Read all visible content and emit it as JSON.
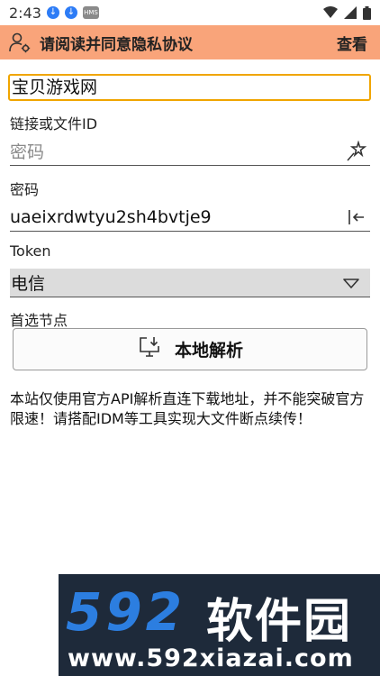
{
  "status_bar": {
    "time": "2:43",
    "hms_label": "HMS"
  },
  "app_bar": {
    "title": "请阅读并同意隐私协议",
    "view_label": "查看"
  },
  "name_field": {
    "value": "宝贝游戏网"
  },
  "link_label": "链接或文件ID",
  "link_field": {
    "placeholder": "密码"
  },
  "password_label": "密码",
  "password_field": {
    "value": "uaeixrdwtyu2sh4bvtje9"
  },
  "token_label": "Token",
  "node_select": {
    "selected": "电信"
  },
  "node_label": "首选节点",
  "parse_button": {
    "label": "本地解析"
  },
  "notice": "本站仅使用官方API解析直连下载地址，并不能突破官方限速！请搭配IDM等工具实现大文件断点续传！",
  "watermark": {
    "number": "592",
    "name": "软件园",
    "url": "www.592xiazai.com"
  },
  "colors": {
    "app_bar": "#f9a47a",
    "focus_border": "#f0a500",
    "watermark_bg": "#1e2a3a",
    "watermark_accent": "#2c7ee0"
  }
}
